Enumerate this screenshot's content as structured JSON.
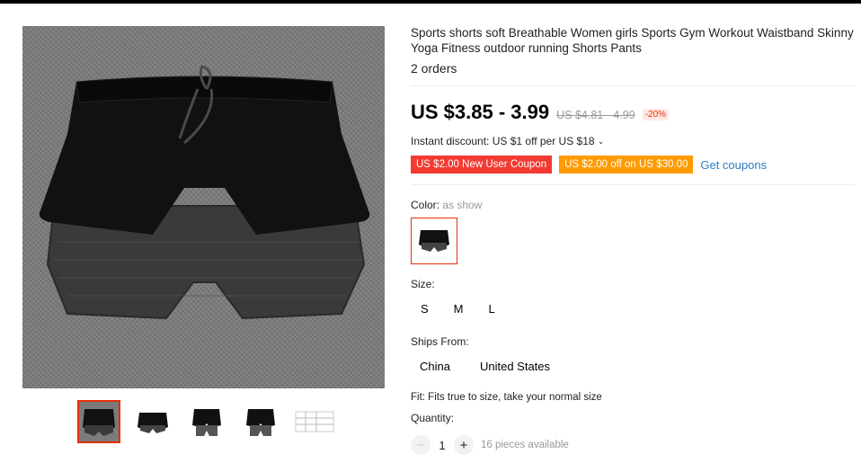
{
  "product": {
    "title": "Sports shorts soft Breathable Women girls Sports Gym Workout Waistband Skinny Yoga Fitness outdoor running Shorts Pants",
    "orders": "2 orders",
    "price": "US $3.85 - 3.99",
    "original_price": "US $4.81 - 4.99",
    "discount": "-20%",
    "instant_discount": "Instant discount: US $1 off per US $18",
    "coupons": [
      "US $2.00 New User Coupon",
      "US $2.00 off on US $30.00"
    ],
    "get_coupons": "Get coupons"
  },
  "color": {
    "label": "Color:",
    "value": "as show"
  },
  "size": {
    "label": "Size:",
    "options": [
      "S",
      "M",
      "L"
    ]
  },
  "ships": {
    "label": "Ships From:",
    "options": [
      "China",
      "United States"
    ]
  },
  "fit": "Fit: Fits true to size, take your normal size",
  "quantity": {
    "label": "Quantity:",
    "value": "1",
    "minus": "−",
    "plus": "+",
    "available": "16 pieces available"
  },
  "gallery": {
    "thumbnail_count": 5,
    "selected_index": 0
  },
  "colors": {
    "accent": "#e62e04",
    "coupon_red": "#f33b32",
    "coupon_orange": "#ff9b00",
    "link": "#2e7cc6"
  }
}
